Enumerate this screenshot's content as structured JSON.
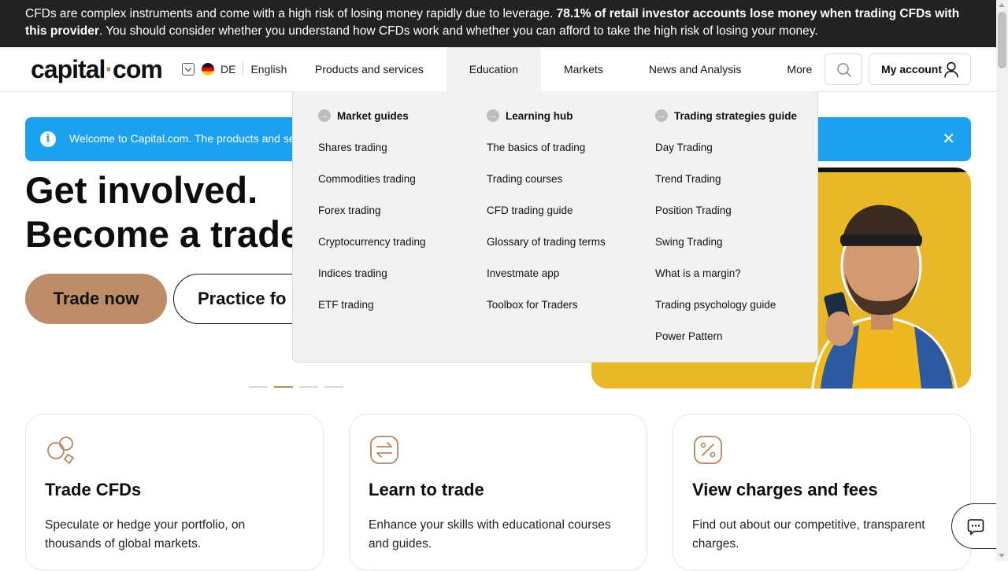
{
  "risk_banner": {
    "text_before": "CFDs are complex instruments and come with a high risk of losing money rapidly due to leverage.",
    "text_bold": "78.1% of retail investor accounts lose money when trading CFDs with this provider",
    "text_after": ". You should consider whether you understand how CFDs work and whether you can afford to take the high risk of losing your money."
  },
  "header": {
    "logo": {
      "main": "capital",
      "dot": "·",
      "tld": "com"
    },
    "region_code": "DE",
    "language": "English",
    "nav": [
      {
        "label": "Products and services"
      },
      {
        "label": "Education"
      },
      {
        "label": "Markets"
      },
      {
        "label": "News and Analysis"
      },
      {
        "label": "More"
      }
    ],
    "account_label": "My account"
  },
  "dropdown": {
    "columns": [
      {
        "heading": "Market guides",
        "items": [
          "Shares trading",
          "Commodities trading",
          "Forex trading",
          "Cryptocurrency trading",
          "Indices trading",
          "ETF trading"
        ]
      },
      {
        "heading": "Learning hub",
        "items": [
          "The basics of trading",
          "Trading courses",
          "CFD trading guide",
          "Glossary of trading terms",
          "Investmate app",
          "Toolbox for Traders"
        ]
      },
      {
        "heading": "Trading strategies guide",
        "items": [
          "Day Trading",
          "Trend Trading",
          "Position Trading",
          "Swing Trading",
          "What is a margin?",
          "Trading psychology guide",
          "Power Pattern"
        ]
      }
    ]
  },
  "welcome": {
    "message": "Welcome to Capital.com. The products and serv"
  },
  "hero": {
    "title_line1": "Get involved.",
    "title_line2": "Become a trade",
    "trade_button": "Trade now",
    "practice_button": "Practice fo"
  },
  "cards": [
    {
      "title": "Trade CFDs",
      "text": "Speculate or hedge your portfolio, on thousands of global markets."
    },
    {
      "title": "Learn to trade",
      "text": "Enhance your skills with educational courses and guides."
    },
    {
      "title": "View charges and fees",
      "text": "Find out about our competitive, transparent charges."
    }
  ],
  "colors": {
    "accent": "#be8d68",
    "info": "#1aa1f0",
    "hero_bg": "#e8b829"
  }
}
